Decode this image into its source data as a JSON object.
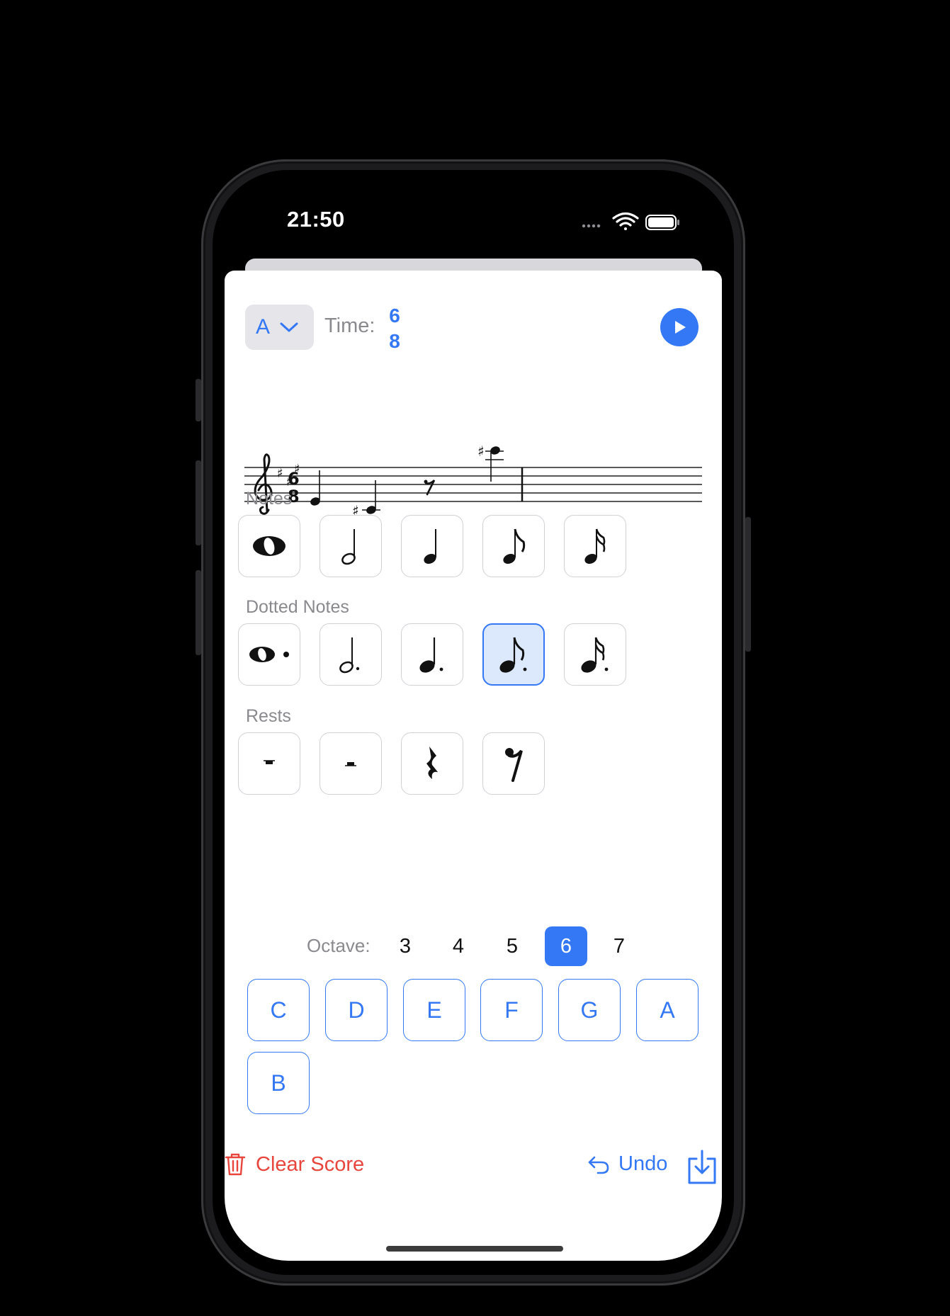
{
  "status_bar": {
    "time": "21:50"
  },
  "header": {
    "key_value": "A",
    "time_label": "Time:",
    "time_numerator": "6",
    "time_denominator": "8"
  },
  "staff": {
    "clef": "treble-clef",
    "key_signature": [
      "♯",
      "♯",
      "♯"
    ],
    "time_signature": [
      "6",
      "8"
    ],
    "items": [
      {
        "kind": "note",
        "pitch": "E4",
        "duration": "quarter"
      },
      {
        "kind": "note",
        "pitch": "C#4",
        "duration": "quarter"
      },
      {
        "kind": "rest",
        "duration": "eighth"
      },
      {
        "kind": "note",
        "pitch": "C#6",
        "duration": "quarter"
      }
    ]
  },
  "sections": {
    "notes_label": "Notes",
    "dotted_label": "Dotted Notes",
    "rests_label": "Rests"
  },
  "notes": [
    "whole-note-icon",
    "half-note-icon",
    "quarter-note-icon",
    "eighth-note-icon",
    "sixteenth-note-icon"
  ],
  "dotted_notes": [
    "dotted-whole-note-icon",
    "dotted-half-note-icon",
    "dotted-quarter-note-icon",
    "dotted-eighth-note-icon",
    "dotted-sixteenth-note-icon"
  ],
  "dotted_selected": "dotted-eighth-note-icon",
  "rests": [
    "whole-rest-icon",
    "half-rest-icon",
    "quarter-rest-icon",
    "eighth-rest-icon"
  ],
  "octave": {
    "label": "Octave:",
    "options": [
      "3",
      "4",
      "5",
      "6",
      "7"
    ],
    "selected": "6"
  },
  "pitches": [
    "C",
    "D",
    "E",
    "F",
    "G",
    "A",
    "B"
  ],
  "footer": {
    "clear_label": "Clear Score",
    "undo_label": "Undo"
  },
  "colors": {
    "accent": "#3478f6",
    "destructive": "#e8453c",
    "selected_bg": "#dce8fc"
  }
}
